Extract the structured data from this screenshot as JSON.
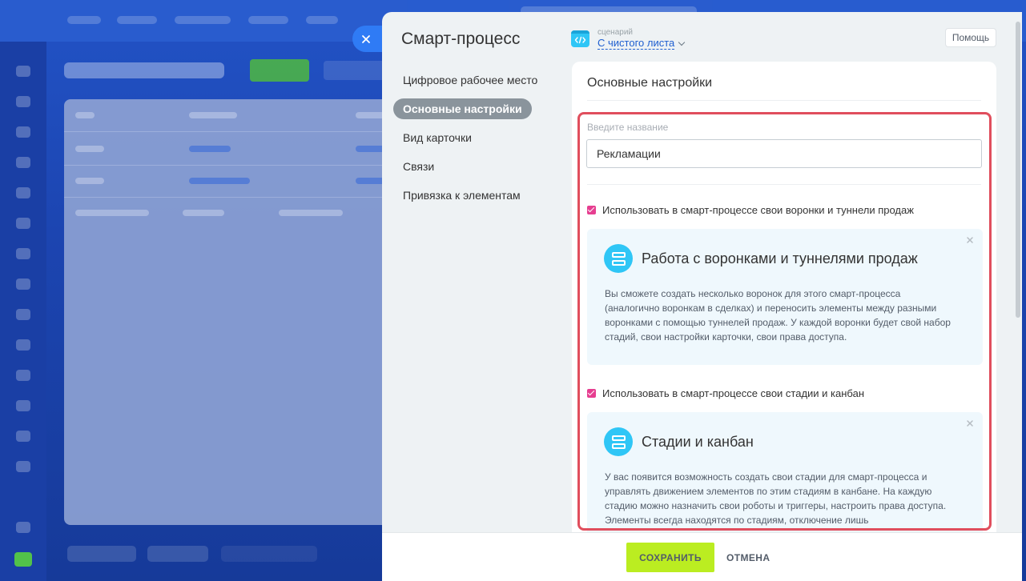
{
  "slider": {
    "title": "Смарт-процесс",
    "scenario": {
      "label": "сценарий",
      "value": "С чистого листа"
    },
    "help_label": "Помощь"
  },
  "nav": {
    "items": [
      {
        "label": "Цифровое рабочее место",
        "active": false
      },
      {
        "label": "Основные настройки",
        "active": true
      },
      {
        "label": "Вид карточки",
        "active": false
      },
      {
        "label": "Связи",
        "active": false
      },
      {
        "label": "Привязка к элементам",
        "active": false
      }
    ]
  },
  "main": {
    "section_title": "Основные настройки",
    "name_field": {
      "label": "Введите название",
      "value": "Рекламации"
    },
    "option1": {
      "checkbox_label": "Использовать в смарт-процессе свои воронки и туннели продаж",
      "checked": true,
      "info_title": "Работа с воронками и туннелями продаж",
      "info_text": "Вы сможете создать несколько воронок для этого смарт-процесса (аналогично воронкам в сделках) и переносить элементы между разными воронками с помощью туннелей продаж. У каждой воронки будет свой набор стадий, свои настройки карточки, свои права доступа."
    },
    "option2": {
      "checkbox_label": "Использовать в смарт-процессе свои стадии и канбан",
      "checked": true,
      "info_title": "Стадии и канбан",
      "info_text": "У вас появится возможность создать свои стадии для смарт-процесса и управлять движением элементов по этим стадиям в канбане. На каждую стадию можно назначить свои роботы и триггеры, настроить права доступа. Элементы всегда находятся по стадиям, отключение лишь"
    }
  },
  "footer": {
    "save_label": "СОХРАНИТЬ",
    "cancel_label": "ОТМЕНА"
  },
  "colors": {
    "accent_blue": "#2f7bf5",
    "highlight_red": "#e04e5d",
    "checkbox_pink": "#e63e90",
    "save_green": "#bbed21",
    "icon_cyan": "#2fc6f6"
  }
}
